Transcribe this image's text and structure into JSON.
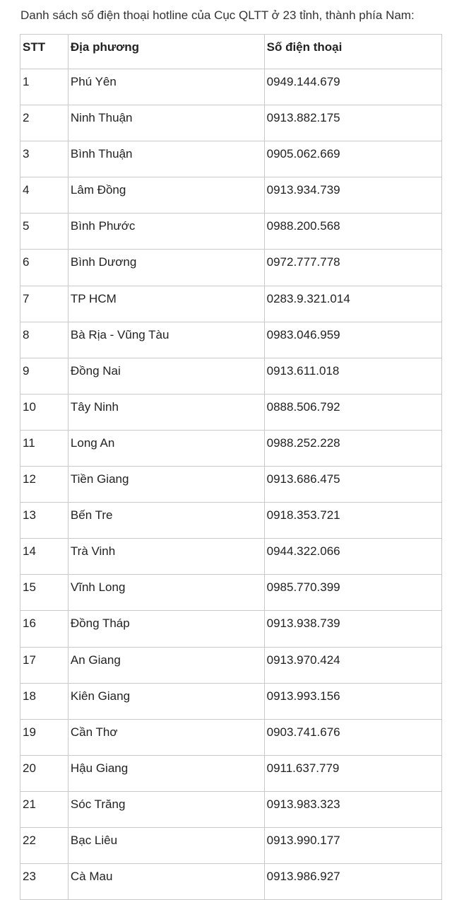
{
  "intro_text": "Danh sách số điện thoại hotline của Cục QLTT ở 23 tỉnh, thành phía Nam:",
  "table": {
    "headers": [
      "STT",
      "Địa phương",
      "Số điện thoại"
    ],
    "rows": [
      [
        "1",
        "Phú Yên",
        "0949.144.679"
      ],
      [
        "2",
        "Ninh Thuận",
        "0913.882.175"
      ],
      [
        "3",
        "Bình Thuận",
        "0905.062.669"
      ],
      [
        "4",
        "Lâm Đồng",
        "0913.934.739"
      ],
      [
        "5",
        "Bình Phước",
        "0988.200.568"
      ],
      [
        "6",
        "Bình Dương",
        "0972.777.778"
      ],
      [
        "7",
        "TP HCM",
        "0283.9.321.014"
      ],
      [
        "8",
        "Bà Rịa - Vũng Tàu",
        "0983.046.959"
      ],
      [
        "9",
        "Đồng Nai",
        "0913.611.018"
      ],
      [
        "10",
        "Tây Ninh",
        "0888.506.792"
      ],
      [
        "11",
        "Long An",
        "0988.252.228"
      ],
      [
        "12",
        "Tiền Giang",
        "0913.686.475"
      ],
      [
        "13",
        "Bến Tre",
        "0918.353.721"
      ],
      [
        "14",
        "Trà Vinh",
        "0944.322.066"
      ],
      [
        "15",
        "Vĩnh Long",
        "0985.770.399"
      ],
      [
        "16",
        "Đồng Tháp",
        "0913.938.739"
      ],
      [
        "17",
        "An Giang",
        "0913.970.424"
      ],
      [
        "18",
        "Kiên Giang",
        "0913.993.156"
      ],
      [
        "19",
        "Cần Thơ",
        "0903.741.676"
      ],
      [
        "20",
        "Hậu Giang",
        "0911.637.779"
      ],
      [
        "21",
        "Sóc Trăng",
        "0913.983.323"
      ],
      [
        "22",
        "Bạc Liêu",
        "0913.990.177"
      ],
      [
        "23",
        "Cà Mau",
        "0913.986.927"
      ]
    ]
  }
}
